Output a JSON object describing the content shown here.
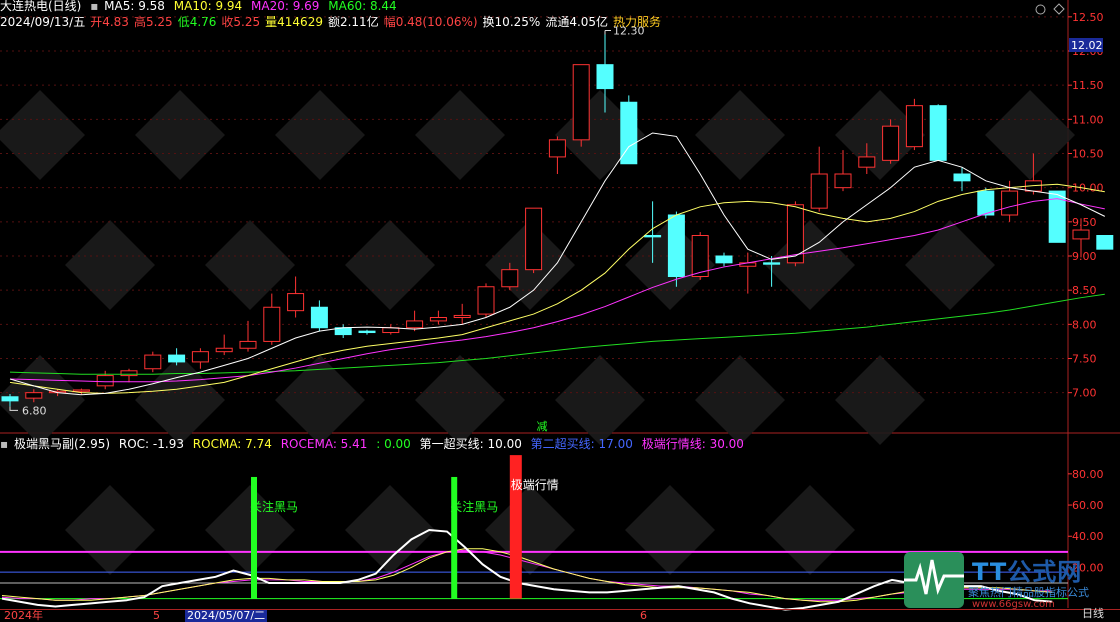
{
  "header": {
    "title": "大连热电(日线)",
    "ma5": "MA5: 9.58",
    "ma10": "MA10: 9.94",
    "ma20": "MA20: 9.69",
    "ma60": "MA60: 8.44",
    "date": "2024/09/13/五",
    "open": "开4.83",
    "high": "高5.25",
    "low": "低4.76",
    "close": "收5.25",
    "volume": "量414629",
    "amount": "额2.11亿",
    "change": "幅0.48(10.06%)",
    "turnover": "换10.25%",
    "float": "流通4.05亿",
    "concept": "热力服务"
  },
  "sub_header": {
    "title": "极端黑马副(2.95)",
    "roc": "ROC: -1.93",
    "rocma": "ROCMA: 7.74",
    "rocema": "ROCEMA: 5.41",
    "zero": ": 0.00",
    "buy1": "第一超买线: 10.00",
    "buy2": "第二超买线: 17.00",
    "extreme": "极端行情线: 30.00"
  },
  "annotations": {
    "high_label": "12.30",
    "low_label": "6.80",
    "price_box": "12.02",
    "reduce": "减",
    "signal1": "关注黑马",
    "signal2": "关注黑马",
    "signal3": "极端行情"
  },
  "bottom_bar": {
    "year": "2024年",
    "m5": "5",
    "date_box": "2024/05/07/二",
    "m6": "6",
    "period": "日线"
  },
  "watermark": {
    "brand": "公式网",
    "slogan": "聚焦热门精品股指标公式",
    "url": "www.66gsw.com"
  },
  "colors": {
    "up": "#ff3333",
    "down": "#54ffff",
    "ma5": "#ffffff",
    "ma10": "#ffff66",
    "ma20": "#ff33ff",
    "ma60": "#22dd22",
    "axis": "#ff3333"
  },
  "chart_data": [
    {
      "type": "candlestick",
      "title": "大连热电(日线)",
      "ylim": [
        6.6,
        12.6
      ],
      "y_ticks": [
        "12.50",
        "12.00",
        "11.50",
        "11.00",
        "10.50",
        "10.00",
        "9.50",
        "9.00",
        "8.50",
        "8.00",
        "7.50",
        "7.00"
      ],
      "y_tick_values": [
        12.5,
        12.0,
        11.5,
        11.0,
        10.5,
        10.0,
        9.5,
        9.0,
        8.5,
        8.0,
        7.5,
        7.0
      ],
      "candles": [
        {
          "o": 6.94,
          "h": 6.98,
          "l": 6.8,
          "c": 6.88
        },
        {
          "o": 6.92,
          "h": 7.05,
          "l": 6.86,
          "c": 7.0
        },
        {
          "o": 7.0,
          "h": 7.05,
          "l": 6.95,
          "c": 7.02
        },
        {
          "o": 7.02,
          "h": 7.06,
          "l": 6.97,
          "c": 7.04
        },
        {
          "o": 7.1,
          "h": 7.32,
          "l": 7.05,
          "c": 7.25
        },
        {
          "o": 7.25,
          "h": 7.35,
          "l": 7.15,
          "c": 7.32
        },
        {
          "o": 7.35,
          "h": 7.6,
          "l": 7.3,
          "c": 7.55
        },
        {
          "o": 7.55,
          "h": 7.65,
          "l": 7.4,
          "c": 7.45
        },
        {
          "o": 7.45,
          "h": 7.65,
          "l": 7.35,
          "c": 7.6
        },
        {
          "o": 7.6,
          "h": 7.85,
          "l": 7.55,
          "c": 7.65
        },
        {
          "o": 7.65,
          "h": 8.05,
          "l": 7.6,
          "c": 7.75
        },
        {
          "o": 7.75,
          "h": 8.45,
          "l": 7.7,
          "c": 8.25
        },
        {
          "o": 8.2,
          "h": 8.7,
          "l": 8.1,
          "c": 8.45
        },
        {
          "o": 8.25,
          "h": 8.35,
          "l": 7.9,
          "c": 7.95
        },
        {
          "o": 7.95,
          "h": 8.0,
          "l": 7.8,
          "c": 7.85
        },
        {
          "o": 7.9,
          "h": 7.92,
          "l": 7.85,
          "c": 7.88
        },
        {
          "o": 7.88,
          "h": 8.0,
          "l": 7.85,
          "c": 7.95
        },
        {
          "o": 7.95,
          "h": 8.2,
          "l": 7.9,
          "c": 8.05
        },
        {
          "o": 8.05,
          "h": 8.2,
          "l": 8.0,
          "c": 8.1
        },
        {
          "o": 8.1,
          "h": 8.3,
          "l": 8.0,
          "c": 8.13
        },
        {
          "o": 8.15,
          "h": 8.6,
          "l": 8.1,
          "c": 8.55
        },
        {
          "o": 8.55,
          "h": 8.9,
          "l": 8.5,
          "c": 8.8
        },
        {
          "o": 8.8,
          "h": 9.7,
          "l": 8.75,
          "c": 9.7
        },
        {
          "o": 10.45,
          "h": 10.75,
          "l": 10.2,
          "c": 10.7
        },
        {
          "o": 10.7,
          "h": 11.8,
          "l": 10.6,
          "c": 11.8
        },
        {
          "o": 11.8,
          "h": 12.3,
          "l": 11.1,
          "c": 11.45
        },
        {
          "o": 11.25,
          "h": 11.35,
          "l": 10.35,
          "c": 10.35
        },
        {
          "o": 9.3,
          "h": 9.8,
          "l": 8.9,
          "c": 9.28
        },
        {
          "o": 9.6,
          "h": 9.65,
          "l": 8.55,
          "c": 8.7
        },
        {
          "o": 8.7,
          "h": 9.35,
          "l": 8.65,
          "c": 9.3
        },
        {
          "o": 9.0,
          "h": 9.05,
          "l": 8.85,
          "c": 8.9
        },
        {
          "o": 8.85,
          "h": 9.05,
          "l": 8.45,
          "c": 8.9
        },
        {
          "o": 8.9,
          "h": 9.0,
          "l": 8.55,
          "c": 8.88
        },
        {
          "o": 8.9,
          "h": 9.8,
          "l": 8.85,
          "c": 9.75
        },
        {
          "o": 9.7,
          "h": 10.6,
          "l": 9.65,
          "c": 10.2
        },
        {
          "o": 10.0,
          "h": 10.55,
          "l": 9.95,
          "c": 10.2
        },
        {
          "o": 10.3,
          "h": 10.65,
          "l": 10.2,
          "c": 10.45
        },
        {
          "o": 10.4,
          "h": 11.0,
          "l": 10.35,
          "c": 10.9
        },
        {
          "o": 10.6,
          "h": 11.3,
          "l": 10.55,
          "c": 11.2
        },
        {
          "o": 11.2,
          "h": 11.22,
          "l": 10.4,
          "c": 10.4
        },
        {
          "o": 10.2,
          "h": 10.3,
          "l": 9.95,
          "c": 10.1
        },
        {
          "o": 9.95,
          "h": 10.0,
          "l": 9.55,
          "c": 9.6
        },
        {
          "o": 9.6,
          "h": 10.1,
          "l": 9.5,
          "c": 9.95
        },
        {
          "o": 9.95,
          "h": 10.5,
          "l": 9.9,
          "c": 10.1
        },
        {
          "o": 9.95,
          "h": 9.95,
          "l": 9.2,
          "c": 9.2
        },
        {
          "o": 9.25,
          "h": 9.55,
          "l": 8.98,
          "c": 9.38
        },
        {
          "o": 9.3,
          "h": 9.3,
          "l": 9.1,
          "c": 9.1
        }
      ],
      "ma5": [
        7.2,
        7.1,
        7.0,
        6.97,
        6.99,
        7.05,
        7.13,
        7.22,
        7.3,
        7.4,
        7.5,
        7.65,
        7.8,
        7.9,
        7.95,
        7.96,
        7.95,
        7.93,
        7.96,
        8.0,
        8.1,
        8.25,
        8.5,
        8.9,
        9.5,
        10.1,
        10.6,
        10.8,
        10.75,
        10.2,
        9.6,
        9.1,
        8.95,
        9.0,
        9.2,
        9.5,
        9.75,
        10.0,
        10.3,
        10.4,
        10.3,
        10.1,
        10.0,
        9.95,
        9.9,
        9.75,
        9.58
      ],
      "ma10": [
        7.15,
        7.1,
        7.05,
        7.0,
        6.99,
        7.0,
        7.02,
        7.05,
        7.1,
        7.15,
        7.25,
        7.35,
        7.45,
        7.55,
        7.62,
        7.68,
        7.72,
        7.76,
        7.8,
        7.85,
        7.95,
        8.05,
        8.15,
        8.3,
        8.5,
        8.75,
        9.1,
        9.4,
        9.6,
        9.72,
        9.78,
        9.8,
        9.78,
        9.72,
        9.62,
        9.55,
        9.5,
        9.55,
        9.65,
        9.8,
        9.9,
        9.97,
        10.0,
        10.03,
        10.05,
        10.0,
        9.94
      ],
      "ma20": [
        7.2,
        7.19,
        7.18,
        7.17,
        7.16,
        7.16,
        7.16,
        7.17,
        7.19,
        7.22,
        7.25,
        7.3,
        7.36,
        7.43,
        7.5,
        7.57,
        7.63,
        7.68,
        7.73,
        7.77,
        7.82,
        7.88,
        7.95,
        8.04,
        8.14,
        8.26,
        8.4,
        8.54,
        8.66,
        8.76,
        8.84,
        8.9,
        8.96,
        9.02,
        9.07,
        9.12,
        9.18,
        9.24,
        9.3,
        9.38,
        9.5,
        9.62,
        9.72,
        9.8,
        9.84,
        9.76,
        9.69
      ],
      "ma60": [
        7.3,
        7.29,
        7.28,
        7.27,
        7.27,
        7.27,
        7.27,
        7.28,
        7.28,
        7.29,
        7.3,
        7.31,
        7.32,
        7.34,
        7.36,
        7.38,
        7.4,
        7.42,
        7.44,
        7.47,
        7.5,
        7.54,
        7.58,
        7.62,
        7.66,
        7.69,
        7.72,
        7.75,
        7.77,
        7.79,
        7.81,
        7.83,
        7.85,
        7.87,
        7.9,
        7.93,
        7.96,
        8.0,
        8.04,
        8.08,
        8.12,
        8.16,
        8.21,
        8.27,
        8.33,
        8.39,
        8.44
      ]
    },
    {
      "type": "line",
      "title": "极端黑马副(2.95)",
      "ylim": [
        -6,
        94
      ],
      "y_ticks": [
        "80.00",
        "60.00",
        "40.00",
        "20.00"
      ],
      "y_tick_values": [
        80,
        60,
        40,
        20
      ],
      "hlines": [
        {
          "name": "极端行情线",
          "value": 30,
          "color": "#ff33ff"
        },
        {
          "name": "第二超买线",
          "value": 17,
          "color": "#4466ff"
        },
        {
          "name": "第一超买线",
          "value": 10,
          "color": "#bbbbbb"
        },
        {
          "name": "零线",
          "value": 0,
          "color": "#22ff22"
        }
      ],
      "roc": [
        0,
        -2,
        -4,
        -5,
        -4,
        -3,
        -2,
        -1,
        1,
        8,
        10,
        12,
        14,
        18,
        15,
        10,
        10,
        10,
        10,
        10,
        12,
        16,
        28,
        38,
        44,
        43,
        33,
        22,
        14,
        10,
        8,
        6,
        5,
        4,
        4,
        5,
        6,
        7,
        8,
        6,
        4,
        0,
        -3,
        -5,
        -7,
        -6,
        -4,
        -2,
        3,
        8,
        12,
        10,
        8,
        7,
        8,
        8,
        5,
        3,
        -1,
        -2
      ],
      "rocma": [
        2,
        1,
        0,
        -1,
        -1,
        -1,
        0,
        1,
        2,
        4,
        6,
        8,
        10,
        12,
        13,
        13,
        12,
        12,
        11,
        11,
        11,
        12,
        15,
        20,
        26,
        30,
        32,
        32,
        30,
        27,
        23,
        19,
        16,
        13,
        11,
        9,
        8,
        7,
        7,
        7,
        6,
        5,
        4,
        2,
        0,
        -1,
        -2,
        -2,
        -1,
        1,
        3,
        5,
        6,
        7,
        7,
        7,
        7,
        6,
        5,
        4
      ],
      "rocema": [
        1,
        0,
        0,
        -1,
        -1,
        0,
        0,
        1,
        2,
        4,
        6,
        8,
        10,
        11,
        12,
        12,
        12,
        11,
        11,
        11,
        11,
        13,
        17,
        22,
        27,
        30,
        31,
        30,
        28,
        25,
        22,
        19,
        16,
        13,
        11,
        10,
        9,
        8,
        8,
        7,
        6,
        5,
        3,
        2,
        0,
        -1,
        -1,
        -1,
        0,
        1,
        3,
        4,
        5,
        6,
        6,
        6,
        6,
        6,
        5,
        5
      ],
      "signals": [
        {
          "label": "关注黑马",
          "at": 10,
          "top": 78,
          "color": "#22ff22"
        },
        {
          "label": "关注黑马",
          "at": 19,
          "top": 78,
          "color": "#22ff22"
        },
        {
          "label": "极端行情",
          "at": 21,
          "top": 92,
          "color": "#ff2222"
        }
      ]
    }
  ]
}
